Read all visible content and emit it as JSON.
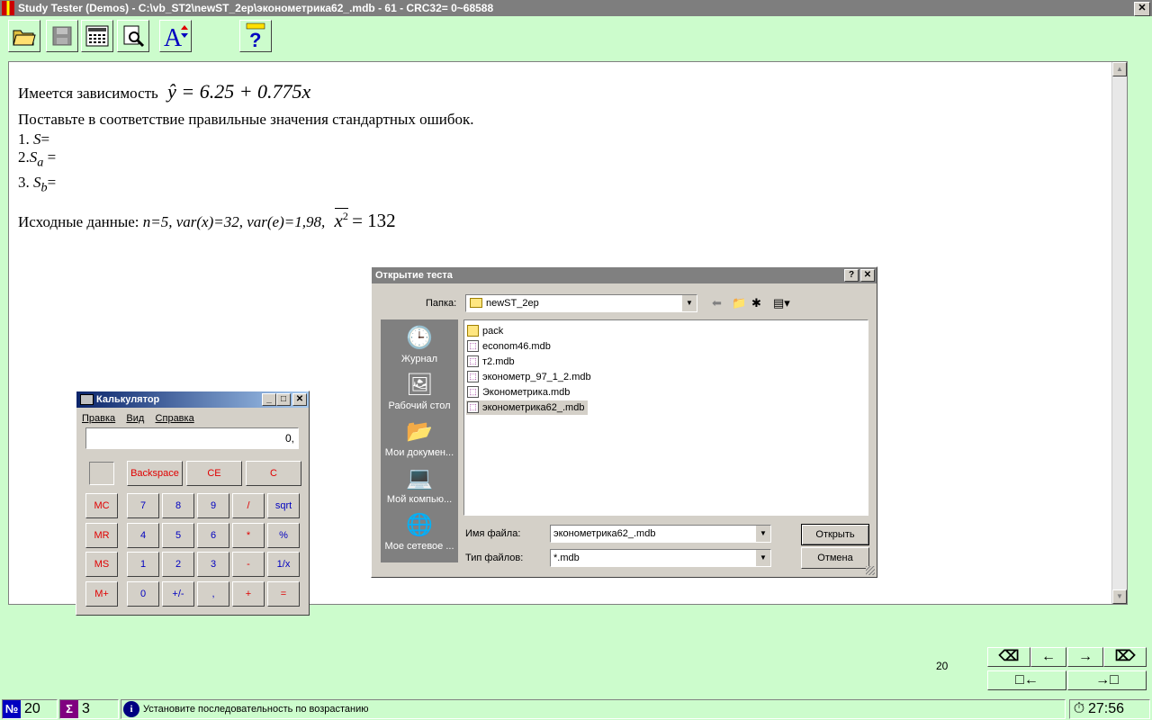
{
  "app": {
    "title": "Study Tester (Demos) - C:\\vb_ST2\\newST_2ep\\эконометрика62_.mdb - 61 - CRC32= 0~68588"
  },
  "question": {
    "line1_text": "Имеется зависимость",
    "line1_formula": "ŷ = 6.25 + 0.775x",
    "line2": "Поставьте в соответствие правильные значения стандартных ошибок.",
    "item1_num": "1.",
    "item1_var": "S",
    "item1_eq": "=",
    "item2_num": "2.",
    "item2_var": "S",
    "item2_sub": "a",
    "item2_eq": "=",
    "item3_num": "3.",
    "item3_var": "S",
    "item3_sub": "b",
    "item3_eq": "=",
    "source_label": "Исходные данные:",
    "source_values": "n=5, var(x)=32, var(e)=1,98,",
    "source_formula_var": "x",
    "source_formula_pow": "2",
    "source_formula_eq": "= 132"
  },
  "calculator": {
    "title": "Калькулятор",
    "menu": [
      "Правка",
      "Вид",
      "Справка"
    ],
    "display": "0,",
    "buttons": {
      "backspace": "Backspace",
      "ce": "CE",
      "c": "C",
      "mc": "MC",
      "mr": "MR",
      "ms": "MS",
      "mplus": "M+",
      "d7": "7",
      "d8": "8",
      "d9": "9",
      "div": "/",
      "sqrt": "sqrt",
      "d4": "4",
      "d5": "5",
      "d6": "6",
      "mul": "*",
      "pct": "%",
      "d1": "1",
      "d2": "2",
      "d3": "3",
      "sub": "-",
      "inv": "1/x",
      "d0": "0",
      "sign": "+/-",
      "dot": ",",
      "add": "+",
      "eq": "="
    }
  },
  "open_dialog": {
    "title": "Открытие теста",
    "folder_label": "Папка:",
    "folder_value": "newST_2ep",
    "places": [
      "Журнал",
      "Рабочий стол",
      "Мои докумен...",
      "Мой компью...",
      "Мое сетевое ..."
    ],
    "files": [
      "pack",
      "econom46.mdb",
      "т2.mdb",
      "эконометр_97_1_2.mdb",
      "Эконометрика.mdb",
      "эконометрика62_.mdb"
    ],
    "filename_label": "Имя файла:",
    "filename_value": "эконометрика62_.mdb",
    "filetype_label": "Тип файлов:",
    "filetype_value": "*.mdb",
    "open_button": "Открыть",
    "cancel_button": "Отмена"
  },
  "page_number": "20",
  "status": {
    "question_count": "20",
    "answered_count": "3",
    "message": "Установите последовательность по возрастанию",
    "timer": "27:56"
  }
}
